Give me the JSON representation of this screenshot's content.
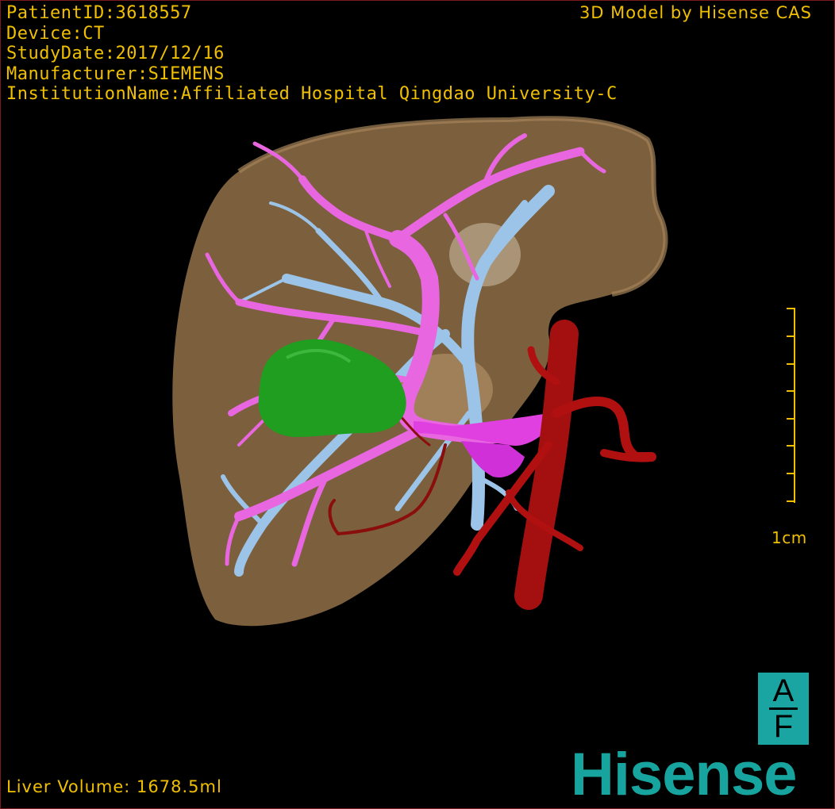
{
  "overlay": {
    "patient_id": "PatientID:3618557",
    "device": "Device:CT",
    "study_date": "StudyDate:2017/12/16",
    "manufacturer": "Manufacturer:SIEMENS",
    "institution": "InstitutionName:Affiliated Hospital Qingdao University-C",
    "model_credit": "3D Model by Hisense CAS",
    "liver_volume": "Liver Volume: 1678.5ml"
  },
  "scale_bar": {
    "label": "1cm"
  },
  "orientation_cube": {
    "top": "A",
    "bottom": "F"
  },
  "logo": {
    "text": "Hisense"
  },
  "colors": {
    "text": "#f0c000",
    "liver": "#8a6a45",
    "portal_vein": "#e866e0",
    "hepatic_vein": "#9cc4e8",
    "artery": "#b01010",
    "tumor": "#1f9e1f",
    "brand": "#17a39e"
  }
}
